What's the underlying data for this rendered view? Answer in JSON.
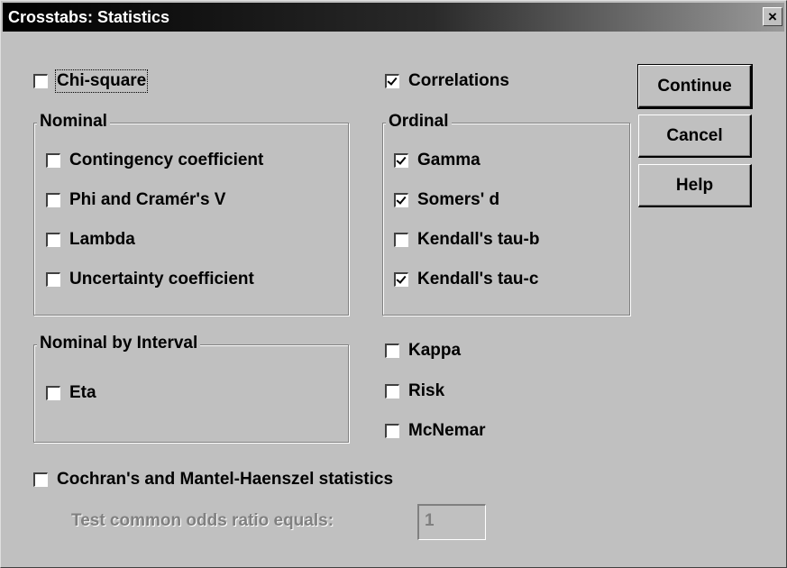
{
  "window": {
    "title": "Crosstabs: Statistics",
    "close_label": "×"
  },
  "chi_square": {
    "label": "Chi-square",
    "checked": false
  },
  "correlations": {
    "label": "Correlations",
    "checked": true
  },
  "nominal": {
    "legend": "Nominal",
    "items": [
      {
        "label": "Contingency coefficient",
        "checked": false
      },
      {
        "label": "Phi and Cramér's V",
        "checked": false
      },
      {
        "label": "Lambda",
        "checked": false
      },
      {
        "label": "Uncertainty coefficient",
        "checked": false
      }
    ]
  },
  "ordinal": {
    "legend": "Ordinal",
    "items": [
      {
        "label": "Gamma",
        "checked": true
      },
      {
        "label": "Somers' d",
        "checked": true
      },
      {
        "label": "Kendall's tau-b",
        "checked": false
      },
      {
        "label": "Kendall's tau-c",
        "checked": true
      }
    ]
  },
  "nominal_by_interval": {
    "legend": "Nominal by Interval",
    "items": [
      {
        "label": "Eta",
        "checked": false
      }
    ]
  },
  "other": {
    "items": [
      {
        "label": "Kappa",
        "checked": false
      },
      {
        "label": "Risk",
        "checked": false
      },
      {
        "label": "McNemar",
        "checked": false
      }
    ]
  },
  "cmh": {
    "label": "Cochran's and Mantel-Haenszel statistics",
    "checked": false
  },
  "odds": {
    "label": "Test common odds ratio equals:",
    "value": "1"
  },
  "buttons": {
    "continue": "Continue",
    "cancel": "Cancel",
    "help": "Help"
  }
}
